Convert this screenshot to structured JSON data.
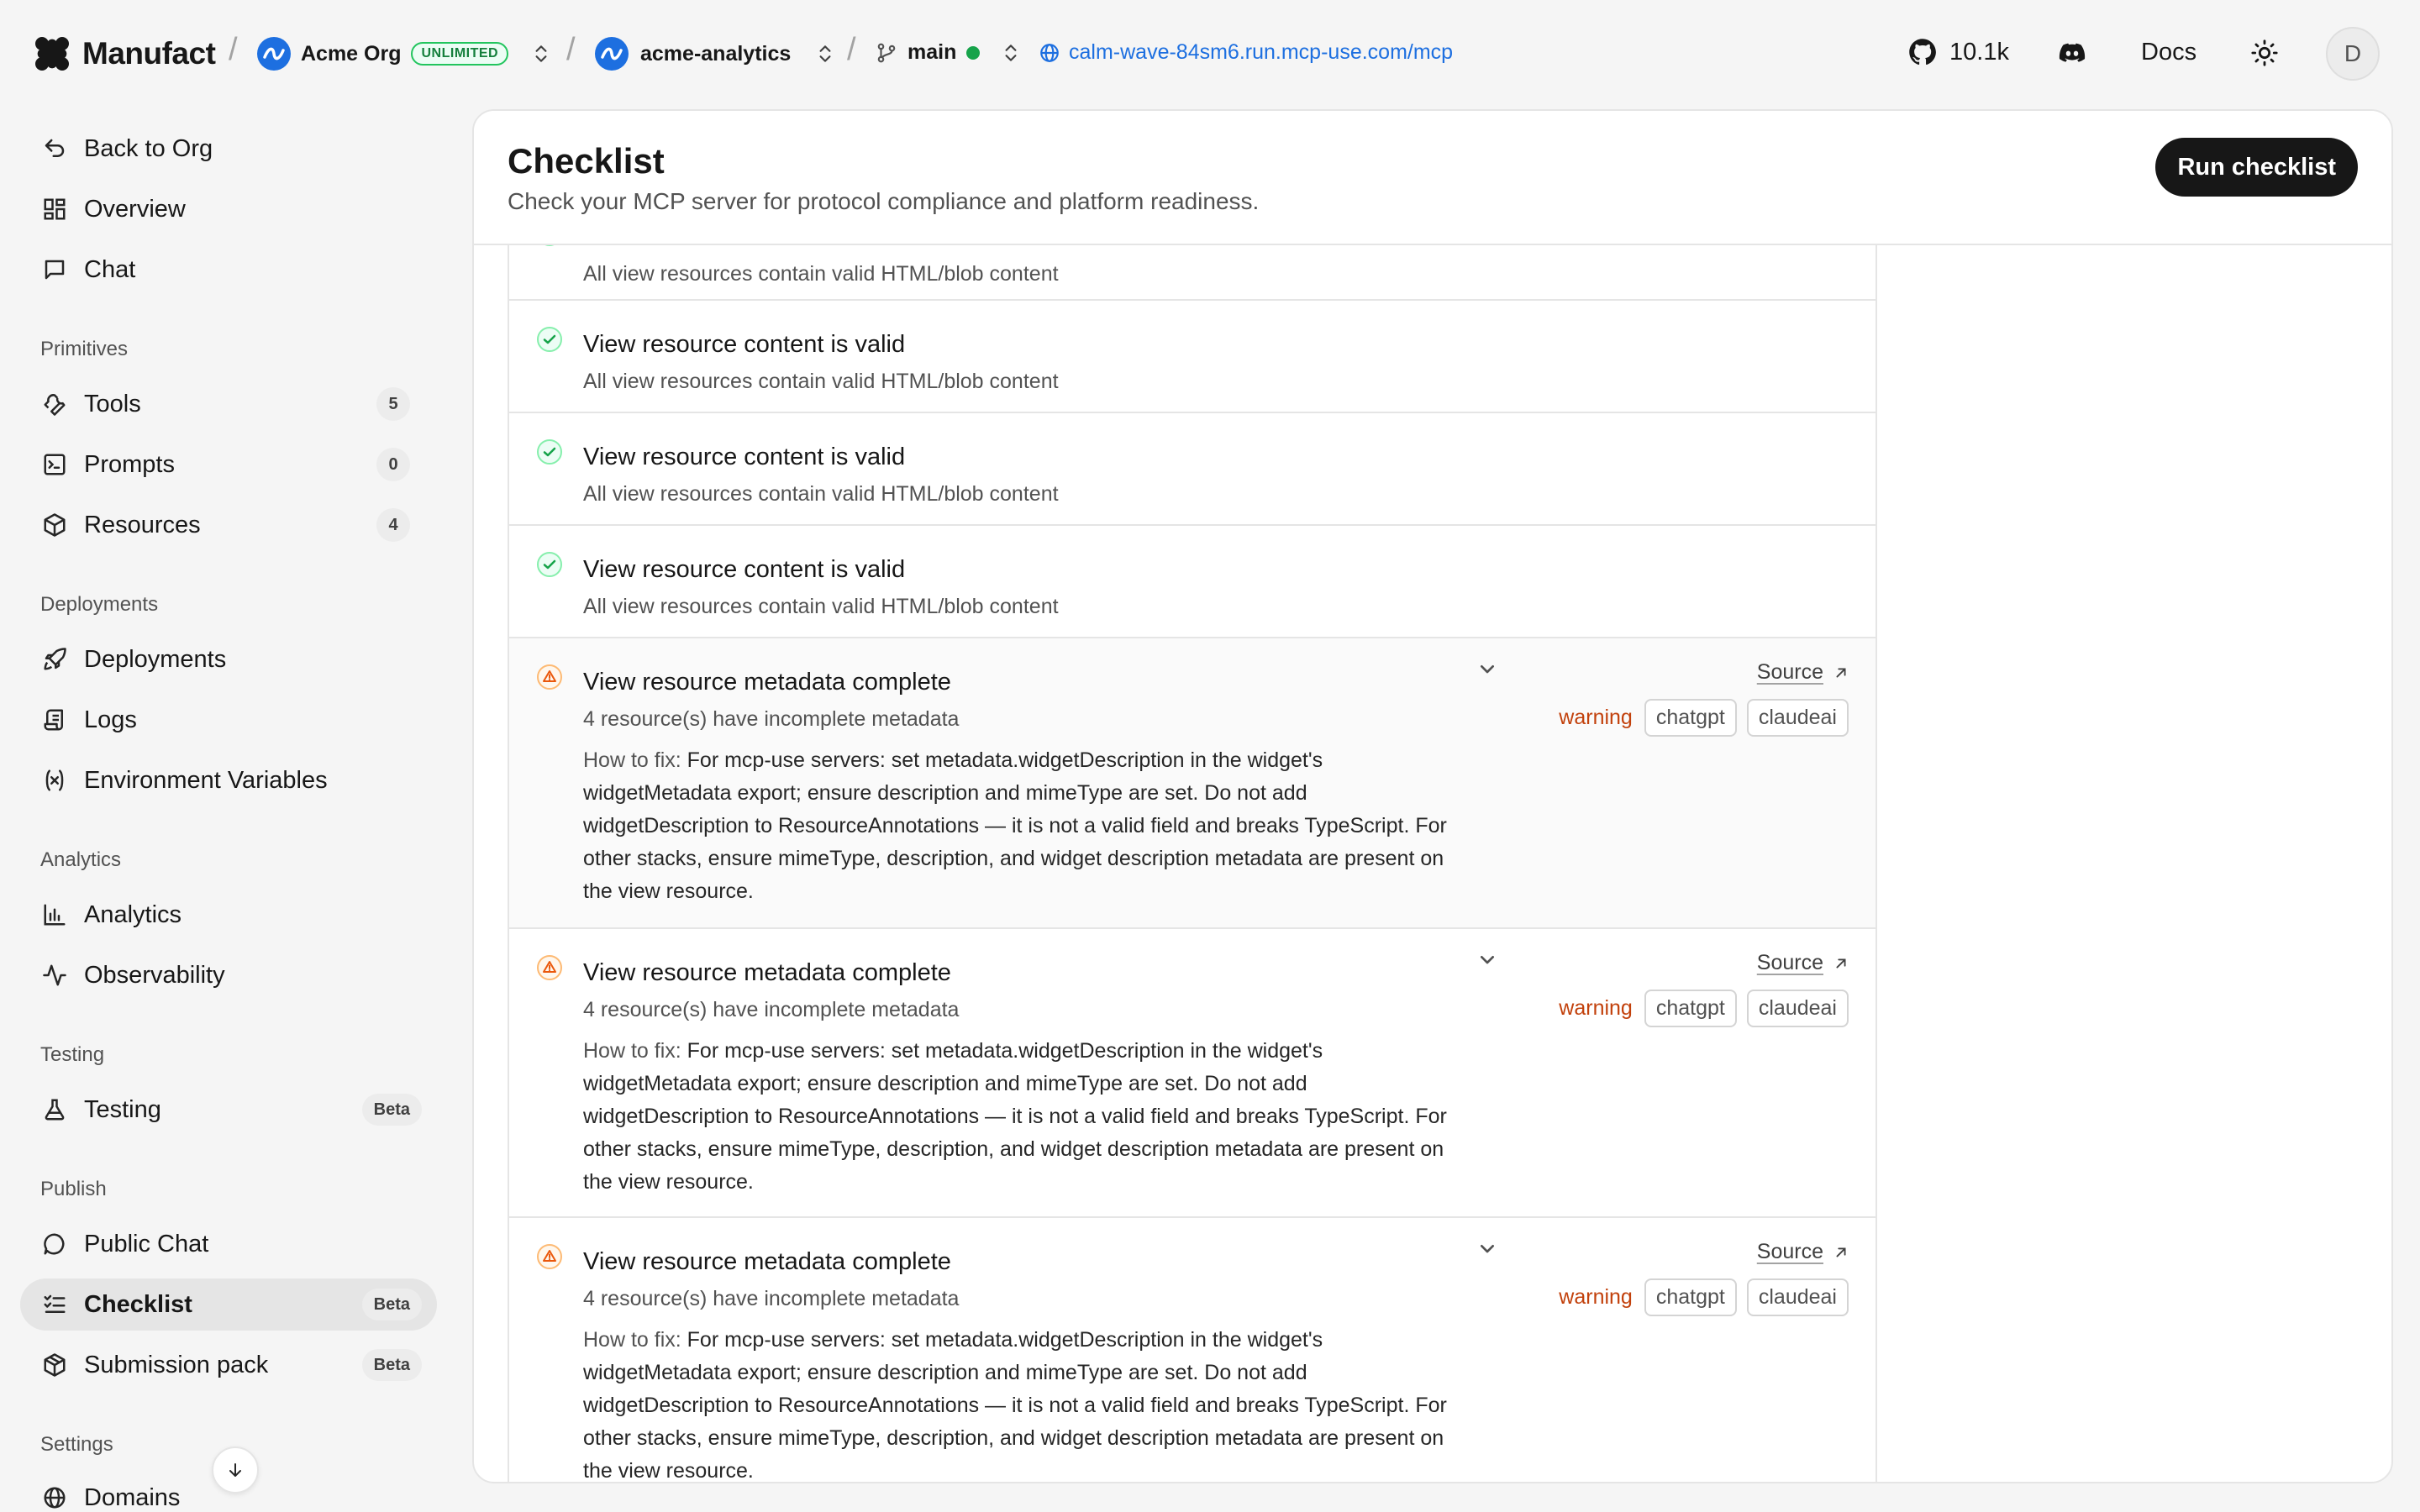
{
  "topbar": {
    "logo_text": "Manufact",
    "org_name": "Acme Org",
    "org_badge": "UNLIMITED",
    "project_name": "acme-analytics",
    "branch": "main",
    "url": "calm-wave-84sm6.run.mcp-use.com/mcp",
    "github_stars": "10.1k",
    "docs": "Docs",
    "avatar_initial": "D"
  },
  "sidebar": {
    "back": "Back to Org",
    "overview": "Overview",
    "chat": "Chat",
    "sections": {
      "primitives": "Primitives",
      "deployments": "Deployments",
      "analytics": "Analytics",
      "testing": "Testing",
      "publish": "Publish",
      "settings": "Settings"
    },
    "tools": "Tools",
    "tools_count": "5",
    "prompts": "Prompts",
    "prompts_count": "0",
    "resources": "Resources",
    "resources_count": "4",
    "deployments": "Deployments",
    "logs": "Logs",
    "env_vars": "Environment Variables",
    "analytics": "Analytics",
    "observability": "Observability",
    "testing": "Testing",
    "public_chat": "Public Chat",
    "checklist": "Checklist",
    "submission_pack": "Submission pack",
    "domains": "Domains",
    "beta": "Beta"
  },
  "page": {
    "title": "Checklist",
    "subtitle": "Check your MCP server for protocol compliance and platform readiness.",
    "run_button": "Run checklist"
  },
  "checks": {
    "pass_title": "View resource content is valid",
    "pass_desc": "All view resources contain valid HTML/blob content",
    "warn_title": "View resource metadata complete",
    "warn_desc": "4 resource(s) have incomplete metadata",
    "fix_label": "How to fix:",
    "fix_text": "For mcp-use servers: set metadata.widgetDescription in the widget's widgetMetadata export; ensure description and mimeType are set. Do not add widgetDescription to ResourceAnnotations — it is not a valid field and breaks TypeScript. For other stacks, ensure mimeType, description, and widget description metadata are present on the view resource.",
    "source": "Source",
    "severity": "warning",
    "tag1": "chatgpt",
    "tag2": "claudeai"
  },
  "colors": {
    "accent_blue": "#1d6fe0",
    "pass_green": "#16a34a",
    "warn_orange": "#c2410c",
    "primary_button": "#171717"
  },
  "icons": [
    "manufact-logo",
    "chevrons-updown-icon",
    "git-branch-icon",
    "globe-icon",
    "github-icon",
    "discord-icon",
    "sun-icon",
    "back-icon",
    "grid-icon",
    "chat-icon",
    "wrench-icon",
    "terminal-icon",
    "cube-icon",
    "rocket-icon",
    "logs-icon",
    "variable-icon",
    "bar-chart-icon",
    "activity-icon",
    "flask-icon",
    "list-check-icon",
    "package-icon",
    "check-circle-icon",
    "warning-icon",
    "chevron-down-icon",
    "external-arrow-icon"
  ]
}
